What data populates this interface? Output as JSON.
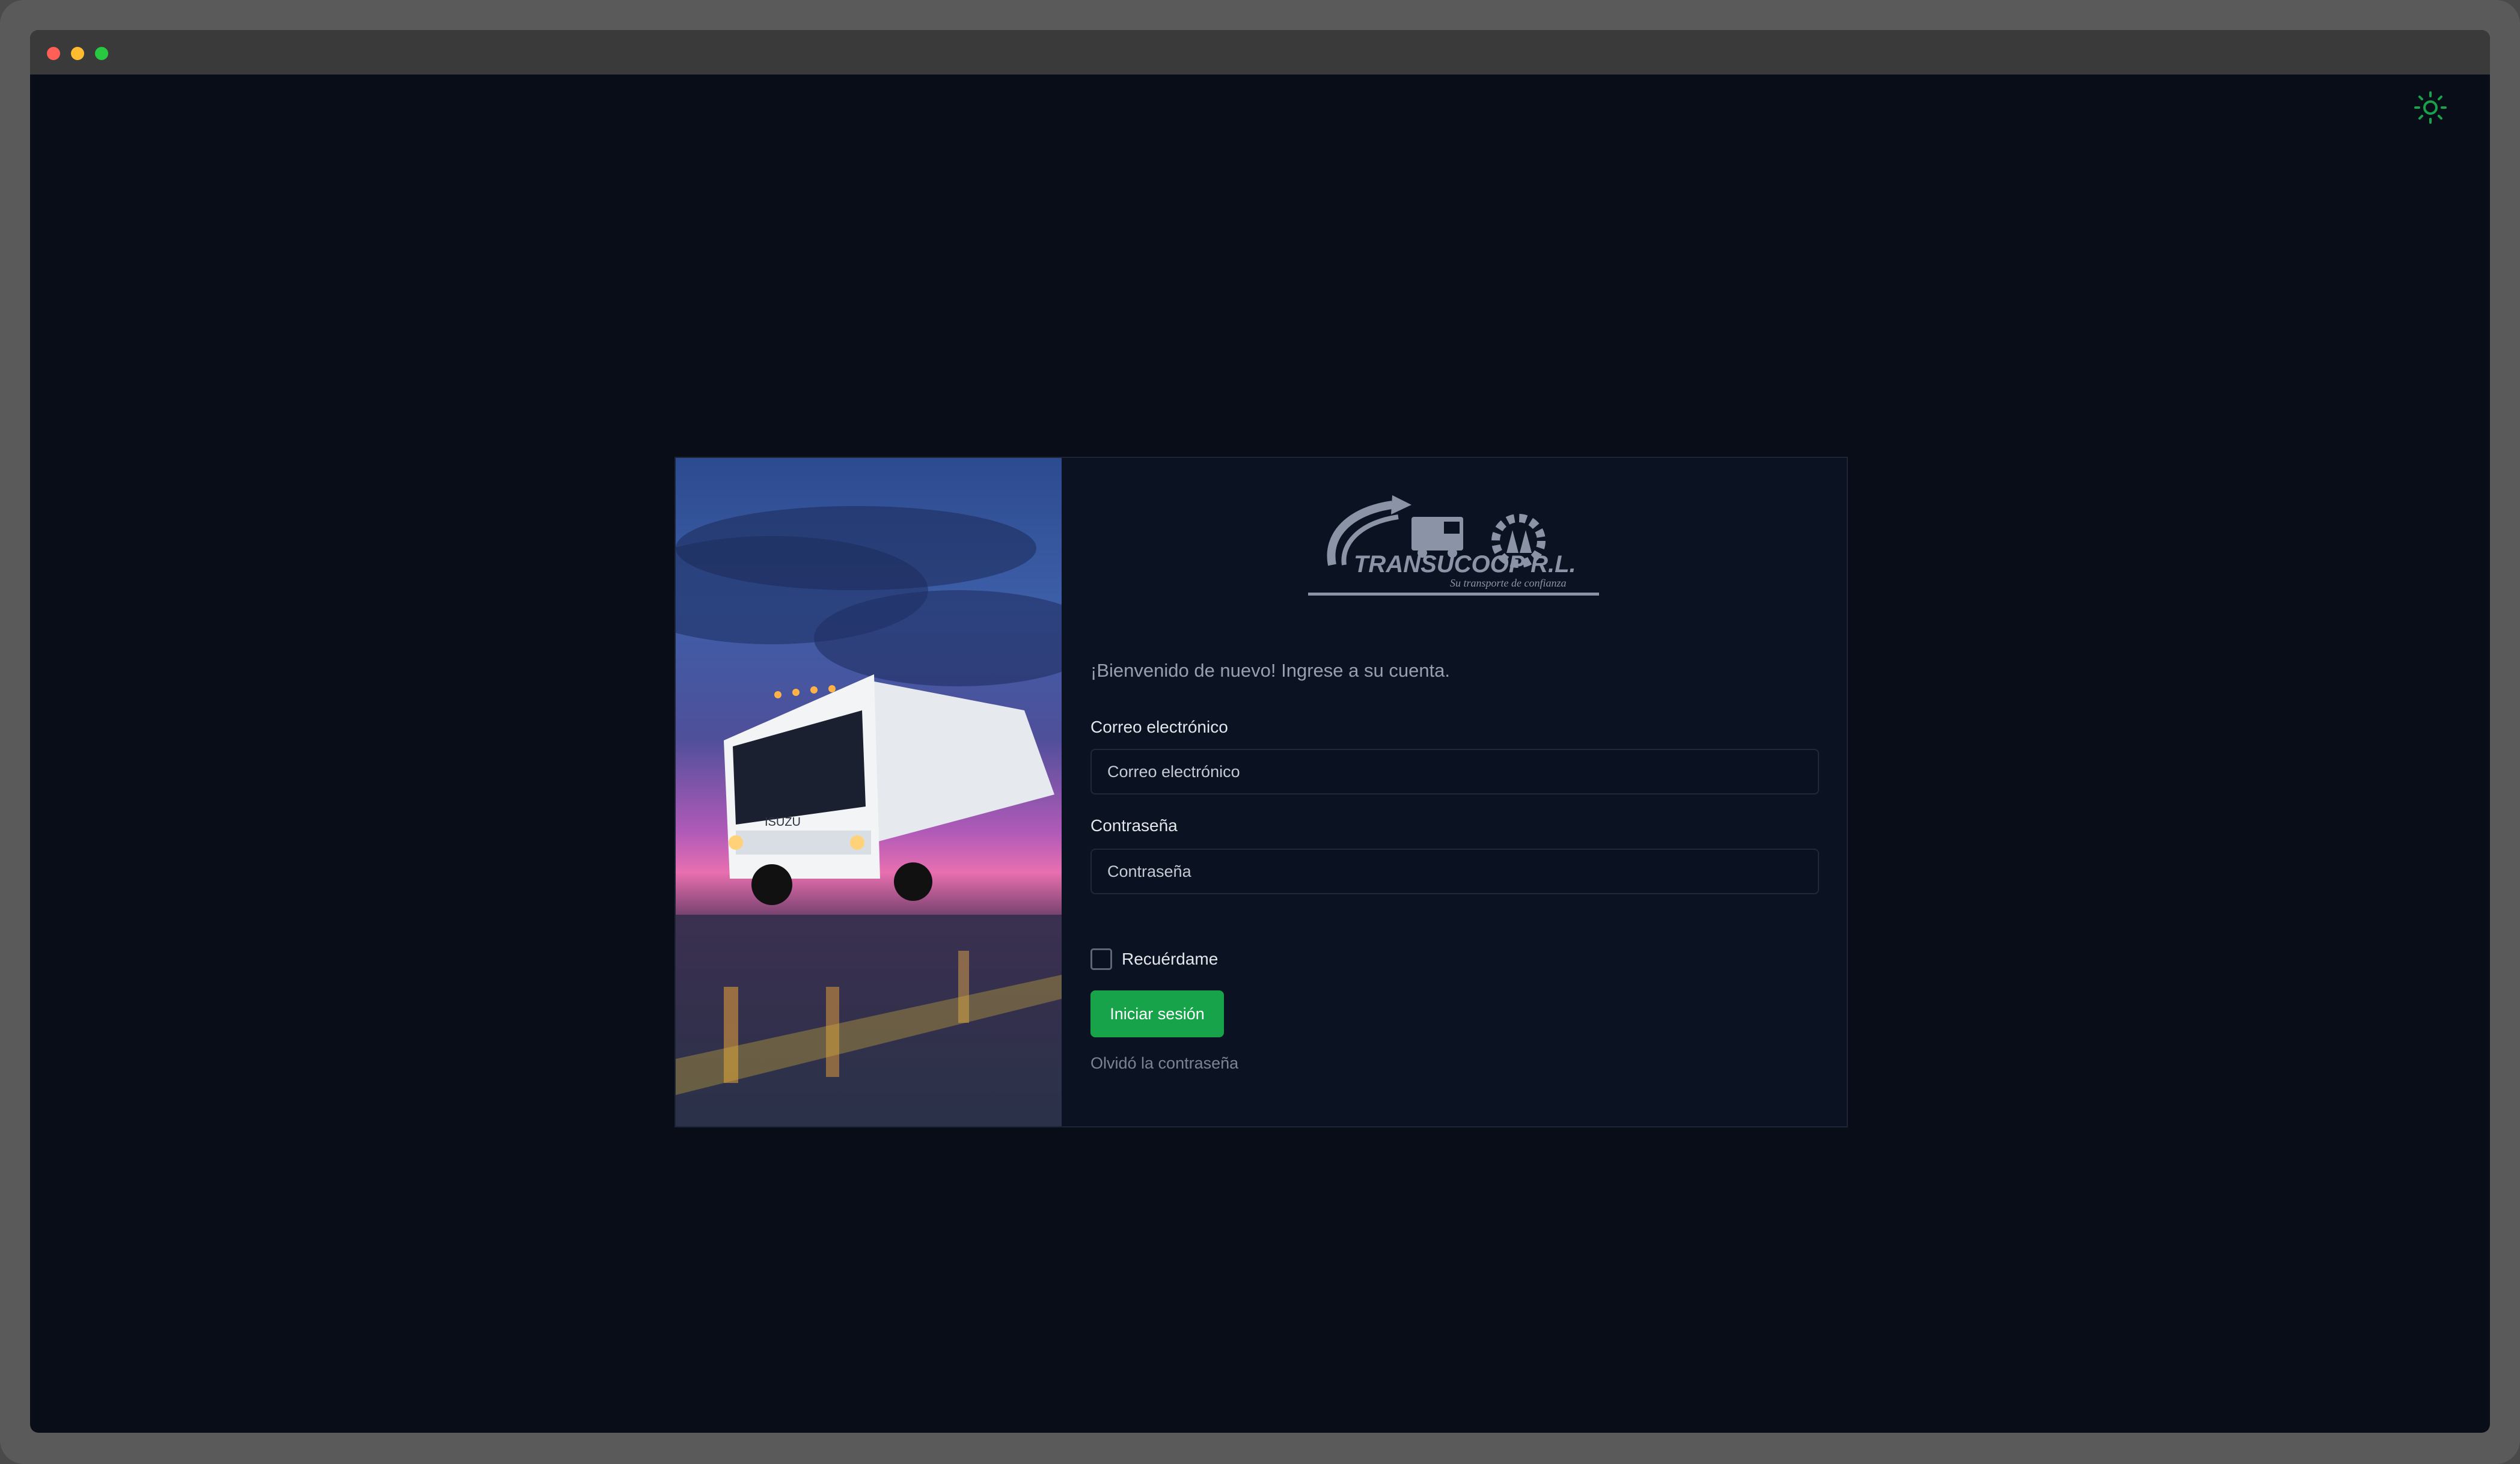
{
  "window": {
    "controls": [
      "close",
      "minimize",
      "maximize"
    ],
    "colors": {
      "close": "#ff5f57",
      "minimize": "#febc2e",
      "maximize": "#28c840"
    }
  },
  "theme_toggle": {
    "icon": "sun-icon",
    "color": "#16a34a"
  },
  "logo": {
    "name": "TRANSUCOOP R.L.",
    "tagline": "Su transporte de confianza"
  },
  "photo": {
    "truck_badge": "ISUZU"
  },
  "form": {
    "welcome": "¡Bienvenido de nuevo! Ingrese a su cuenta.",
    "email_label": "Correo electrónico",
    "email_placeholder": "Correo electrónico",
    "password_label": "Contraseña",
    "password_placeholder": "Contraseña",
    "remember_label": "Recuérdame",
    "remember_checked": false,
    "submit_label": "Iniciar sesión",
    "forgot_label": "Olvidó la contraseña"
  },
  "colors": {
    "background": "#090d17",
    "card": "#0b1222",
    "accent": "#16a34a",
    "logo": "#8b93a6"
  }
}
